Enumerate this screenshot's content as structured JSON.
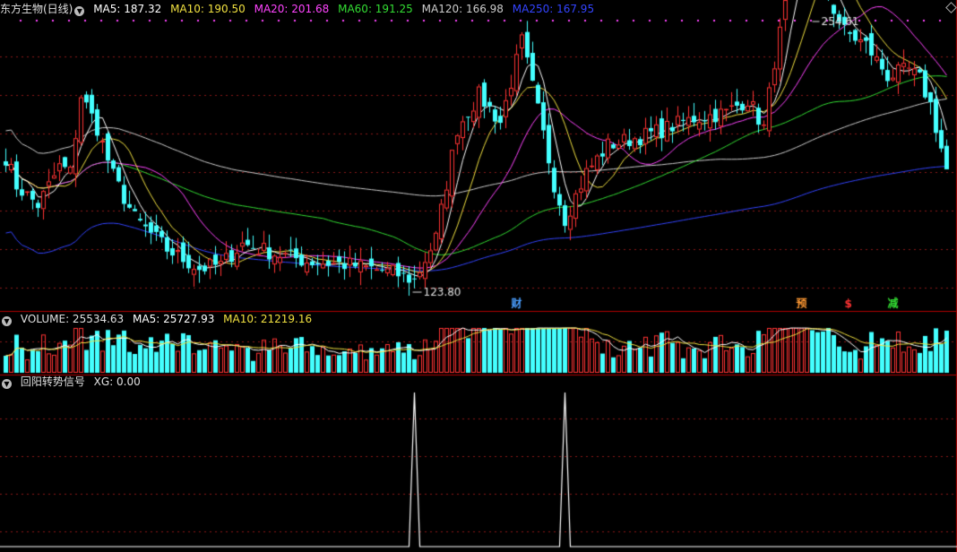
{
  "header": {
    "title": "东方生物(日线)",
    "ma": [
      {
        "label": "MA5: 187.32",
        "color": "#ffffff"
      },
      {
        "label": "MA10: 190.50",
        "color": "#f0e040"
      },
      {
        "label": "MA20: 201.68",
        "color": "#ff44ff"
      },
      {
        "label": "MA60: 191.25",
        "color": "#33dd33"
      },
      {
        "label": "MA120: 166.98",
        "color": "#cccccc"
      },
      {
        "label": "MA250: 167.95",
        "color": "#3344ff"
      }
    ]
  },
  "volume_header": {
    "title": "VOLUME: 25534.63",
    "ma5": "MA5: 25727.93",
    "ma10": "MA10: 21219.16"
  },
  "signal_header": {
    "title": "回阳转势信号",
    "xg": "XG: 0.00"
  },
  "chart_data": {
    "type": "candlestick",
    "price_high_label": "254.61",
    "price_low_label": "123.80",
    "markers": [
      {
        "text": "财",
        "color": "#4a9eff",
        "index": 95
      },
      {
        "text": "预",
        "color": "#ff9933",
        "index": 148
      },
      {
        "text": "$",
        "color": "#ff3333",
        "index": 157
      },
      {
        "text": "减",
        "color": "#33dd33",
        "index": 165
      }
    ],
    "signal_spikes": [
      76,
      104
    ],
    "colors": {
      "up": "#ff3333",
      "down": "#44ffff",
      "ma5": "#ffffff",
      "ma10": "#f0e040",
      "ma20": "#ff44ff",
      "ma60": "#33dd33",
      "ma120": "#cccccc",
      "ma250": "#3344ff",
      "grid": "#8b1a1a",
      "axis": "#b00000"
    }
  }
}
